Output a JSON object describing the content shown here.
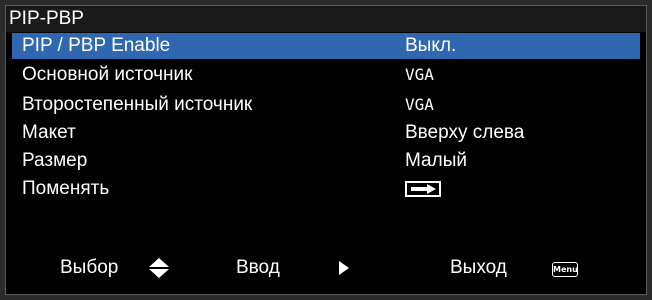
{
  "menu": {
    "title": "PIP-PBP",
    "items": [
      {
        "label": "PIP / PBP Enable",
        "value": "Выкл."
      },
      {
        "label": "Основной источник",
        "value": "VGA"
      },
      {
        "label": "Второстепенный источник",
        "value": "VGA"
      },
      {
        "label": "Макет",
        "value": "Вверху слева"
      },
      {
        "label": "Размер",
        "value": "Малый"
      },
      {
        "label": "Поменять",
        "value_icon": "swap-arrow-icon"
      }
    ]
  },
  "footer": {
    "select_label": "Выбор",
    "select_icon": "up-down-arrows-icon",
    "enter_label": "Ввод",
    "enter_icon": "right-arrow-icon",
    "exit_label": "Выход",
    "exit_key_label": "Menu"
  },
  "colors": {
    "highlight": "#2f68b0",
    "background": "#000000",
    "text": "#ffffff"
  }
}
